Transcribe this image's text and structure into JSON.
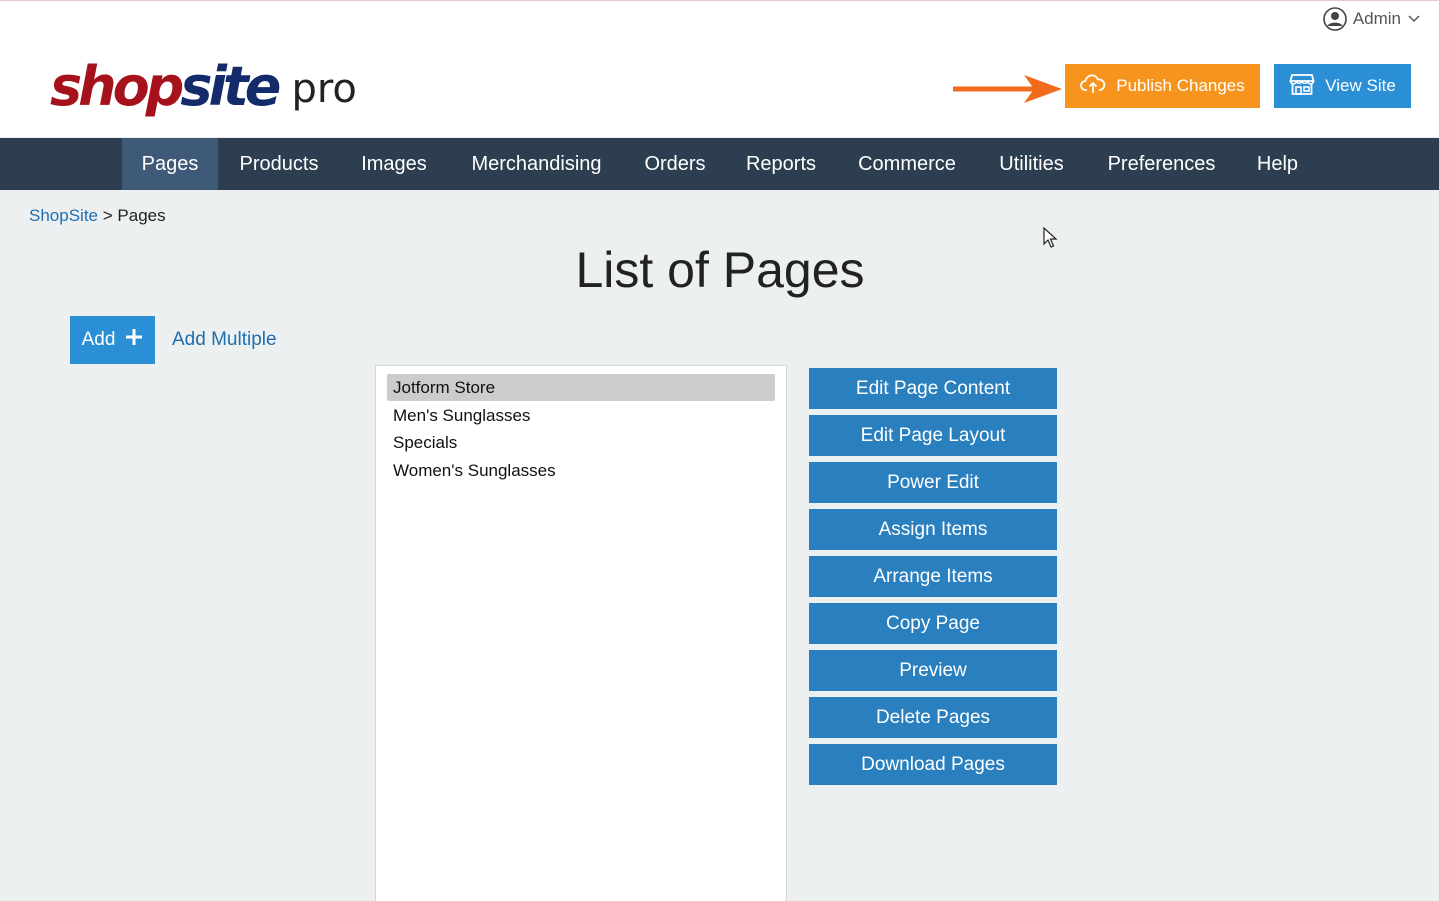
{
  "header": {
    "user_label": "Admin",
    "logo": {
      "part1": "shop",
      "part2": "site",
      "suffix": "pro"
    },
    "publish_label": "Publish Changes",
    "view_site_label": "View Site"
  },
  "nav": {
    "items": [
      {
        "label": "Pages",
        "active": true
      },
      {
        "label": "Products"
      },
      {
        "label": "Images"
      },
      {
        "label": "Merchandising"
      },
      {
        "label": "Orders"
      },
      {
        "label": "Reports"
      },
      {
        "label": "Commerce"
      },
      {
        "label": "Utilities"
      },
      {
        "label": "Preferences"
      },
      {
        "label": "Help"
      }
    ]
  },
  "breadcrumb": {
    "root": "ShopSite",
    "separator": ">",
    "current": "Pages"
  },
  "main": {
    "title": "List of Pages",
    "add_label": "Add",
    "add_multiple_label": "Add Multiple",
    "pages": [
      {
        "name": "Jotform Store",
        "selected": true
      },
      {
        "name": "Men's Sunglasses"
      },
      {
        "name": "Specials"
      },
      {
        "name": "Women's Sunglasses"
      }
    ],
    "actions": [
      "Edit Page Content",
      "Edit Page Layout",
      "Power Edit",
      "Assign Items",
      "Arrange Items",
      "Copy Page",
      "Preview",
      "Delete Pages",
      "Download Pages"
    ]
  },
  "colors": {
    "publish": "#f7941d",
    "primary": "#2b8fd6",
    "nav_bg": "#2c3e50",
    "nav_active": "#3e5a78",
    "action": "#2a7fbf",
    "arrow": "#f26a1b"
  }
}
